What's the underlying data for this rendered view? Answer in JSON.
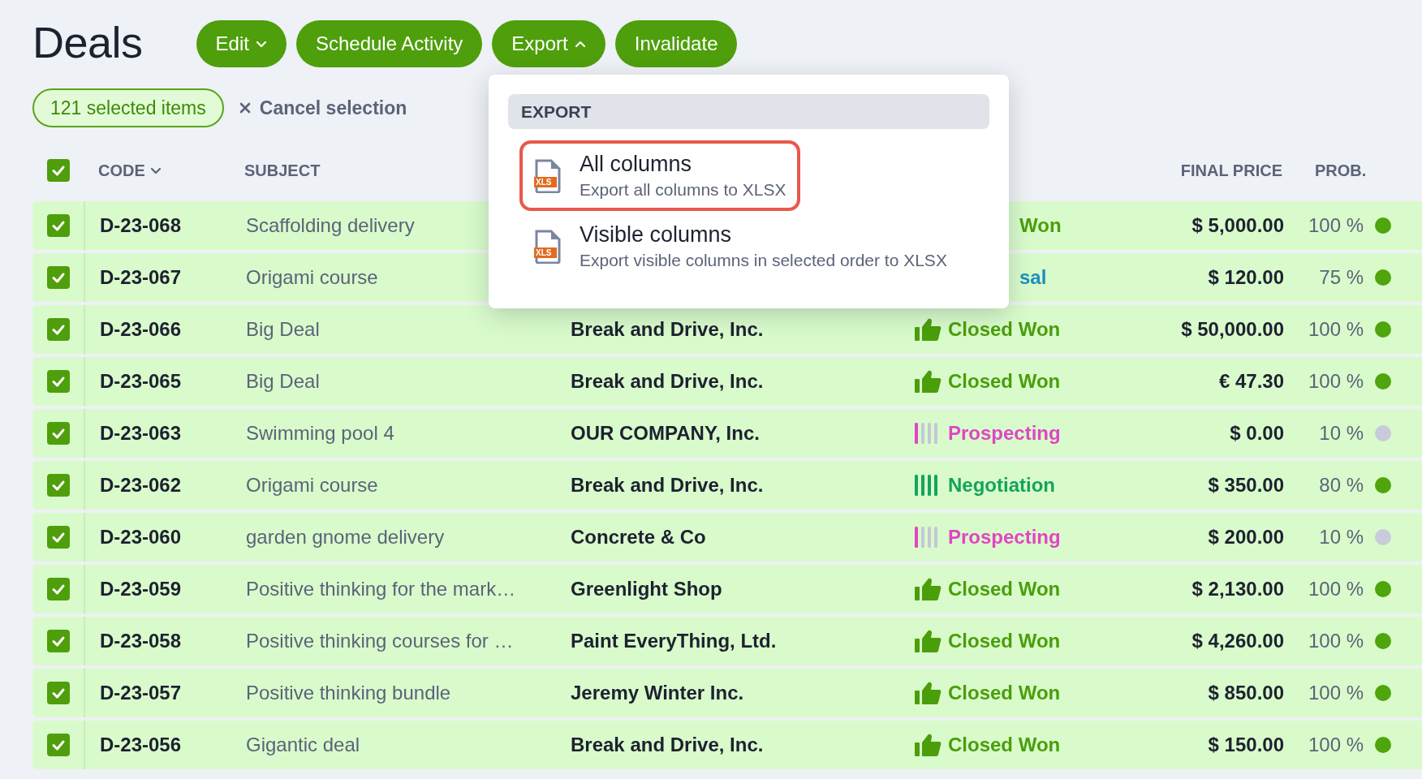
{
  "title": "Deals",
  "toolbar": [
    {
      "label": "Edit",
      "expanded": false
    },
    {
      "label": "Schedule Activity"
    },
    {
      "label": "Export",
      "expanded": true
    },
    {
      "label": "Invalidate"
    }
  ],
  "selection": {
    "count": "121 selected items",
    "cancel": "Cancel selection"
  },
  "table": {
    "select_all": {
      "checked": true
    },
    "columns": [
      {
        "label": "CODE",
        "sorted": true
      },
      {
        "label": "SUBJECT",
        "sorted": false
      },
      {
        "label": "FINAL PRICE",
        "sorted": false
      },
      {
        "label": "PROB.",
        "sorted": false
      }
    ],
    "rows": [
      {
        "checked": true,
        "code": "D-23-068",
        "subject": "Scaffolding delivery",
        "stage": {
          "label": "Won",
          "kind": "won"
        },
        "price": "$ 5,000.00",
        "prob": "100 %",
        "color": "#4ea50c"
      },
      {
        "checked": true,
        "code": "D-23-067",
        "subject": "Origami course",
        "stage": {
          "label": "sal",
          "kind": "proposal"
        },
        "price": "$ 120.00",
        "prob": "75 %",
        "color": "#4ea50c"
      },
      {
        "checked": true,
        "code": "D-23-066",
        "subject": "Big Deal",
        "customer": "Break and Drive, Inc.",
        "stage": {
          "label": "Closed Won",
          "kind": "won"
        },
        "price": "$ 50,000.00",
        "prob": "100 %",
        "color": "#4ea50c"
      },
      {
        "checked": true,
        "code": "D-23-065",
        "subject": "Big Deal",
        "customer": "Break and Drive, Inc.",
        "stage": {
          "label": "Closed Won",
          "kind": "won"
        },
        "price": "€ 47.30",
        "prob": "100 %",
        "color": "#4ea50c"
      },
      {
        "checked": true,
        "code": "D-23-063",
        "subject": "Swimming pool 4",
        "customer": "OUR COMPANY, Inc.",
        "stage": {
          "label": "Prospecting",
          "kind": "prospecting"
        },
        "price": "$ 0.00",
        "prob": "10 %",
        "color": "#c8ccda"
      },
      {
        "checked": true,
        "code": "D-23-062",
        "subject": "Origami course",
        "customer": "Break and Drive, Inc.",
        "stage": {
          "label": "Negotiation",
          "kind": "negotiation"
        },
        "price": "$ 350.00",
        "prob": "80 %",
        "color": "#4ea50c"
      },
      {
        "checked": true,
        "code": "D-23-060",
        "subject": "garden gnome delivery",
        "customer": "Concrete & Co",
        "stage": {
          "label": "Prospecting",
          "kind": "prospecting"
        },
        "price": "$ 200.00",
        "prob": "10 %",
        "color": "#c8ccda"
      },
      {
        "checked": true,
        "code": "D-23-059",
        "subject": "Positive thinking for the mark…",
        "customer": "Greenlight Shop",
        "stage": {
          "label": "Closed Won",
          "kind": "won"
        },
        "price": "$ 2,130.00",
        "prob": "100 %",
        "color": "#4ea50c"
      },
      {
        "checked": true,
        "code": "D-23-058",
        "subject": "Positive thinking courses for …",
        "customer": "Paint EveryThing, Ltd.",
        "stage": {
          "label": "Closed Won",
          "kind": "won"
        },
        "price": "$ 4,260.00",
        "prob": "100 %",
        "color": "#4ea50c"
      },
      {
        "checked": true,
        "code": "D-23-057",
        "subject": "Positive thinking bundle",
        "customer": "Jeremy Winter Inc.",
        "stage": {
          "label": "Closed Won",
          "kind": "won"
        },
        "price": "$ 850.00",
        "prob": "100 %",
        "color": "#4ea50c"
      },
      {
        "checked": true,
        "code": "D-23-056",
        "subject": "Gigantic deal",
        "customer": "Break and Drive, Inc.",
        "stage": {
          "label": "Closed Won",
          "kind": "won"
        },
        "price": "$ 150.00",
        "prob": "100 %",
        "color": "#4ea50c"
      }
    ]
  },
  "export_menu": {
    "heading": "EXPORT",
    "items": [
      {
        "title": "All columns",
        "description": "Export all columns to XLSX",
        "badge": "XLS",
        "selected": true
      },
      {
        "title": "Visible columns",
        "description": "Export visible columns in selected order to XLSX",
        "badge": "XLS",
        "selected": false
      }
    ]
  }
}
